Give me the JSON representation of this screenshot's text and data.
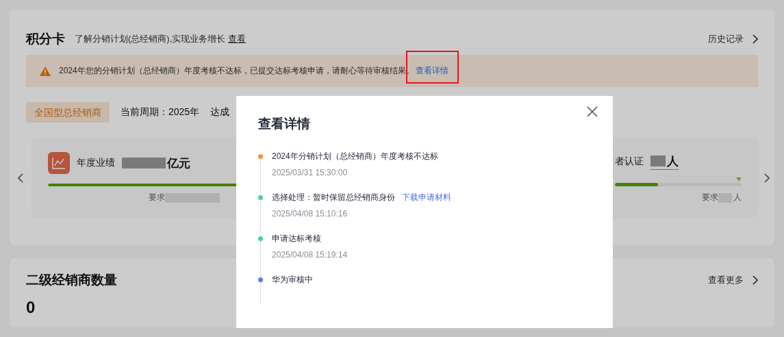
{
  "header": {
    "title": "积分卡",
    "subtitle": "了解分销计划(总经销商),实现业务增长",
    "subtitle_link": "查看",
    "history": "历史记录"
  },
  "alert": {
    "kind": "warning",
    "message": "2024年您的分销计划（总经销商）年度考核不达标，已提交达标考核申请，请耐心等待审核结果。",
    "link": "查看详情",
    "highlighted": true
  },
  "summary": {
    "tag": "全国型总经销商",
    "period": "当前周期：2025年",
    "goal_label": "达成"
  },
  "metrics": [
    {
      "label": "年度业绩",
      "unit": "亿元",
      "requirement_label": "要求",
      "level": 0.7
    },
    {
      "label": "者认证",
      "unit": "人",
      "requirement_label": "要求",
      "requirement_unit": "人",
      "level": 0.34,
      "target_marker": true
    }
  ],
  "second_card": {
    "title": "二级经销商数量",
    "more": "查看更多",
    "value": "0"
  },
  "modal": {
    "title": "查看详情",
    "timeline": [
      {
        "text": "2024年分销计划（总经销商）年度考核不达标",
        "time": "2025/03/31 15:30:00",
        "color": "#f5953f"
      },
      {
        "text": "选择处理：暂时保留总经销商身份",
        "link": "下载申请材料",
        "time": "2025/04/08 15:10:16",
        "color": "#45d1a4"
      },
      {
        "text": "申请达标考核",
        "time": "2025/04/08 15:19:14",
        "color": "#45d1a4"
      },
      {
        "text": "华为审核中",
        "color": "#5a7ce6"
      }
    ]
  }
}
